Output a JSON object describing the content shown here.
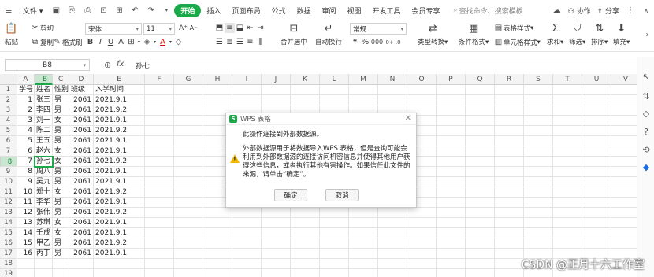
{
  "menubar": {
    "file_label": "文件",
    "tabs": [
      "开始",
      "插入",
      "页面布局",
      "公式",
      "数据",
      "审阅",
      "视图",
      "开发工具",
      "会员专享"
    ],
    "active_tab": "开始",
    "search_placeholder": "查找命令、搜索模板",
    "collab_label": "协作",
    "share_label": "分享"
  },
  "toolbar": {
    "paste_label": "粘贴",
    "cut_label": "剪切",
    "copy_label": "复制",
    "format_painter_label": "格式刷",
    "font_name": "宋体",
    "font_size": "11",
    "merge_center_label": "合并居中",
    "wrap_label": "自动换行",
    "number_format": "常规",
    "type_convert_label": "类型转换",
    "cond_format_label": "条件格式",
    "table_style_label": "表格样式",
    "cell_style_label": "单元格样式",
    "sum_label": "求和",
    "filter_label": "筛选",
    "sort_label": "排序",
    "fill_label": "填充",
    "percent": "%",
    "thousands": "000"
  },
  "formula_bar": {
    "cell_ref": "B8",
    "fx_label": "fx",
    "value": "孙七"
  },
  "sheet": {
    "columns": [
      "A",
      "B",
      "C",
      "D",
      "E",
      "F",
      "G",
      "H",
      "I",
      "J",
      "K",
      "L",
      "M",
      "N",
      "O",
      "P",
      "Q",
      "R",
      "S",
      "T",
      "U",
      "V"
    ],
    "selected_column": "B",
    "selected_row": "8",
    "row_numbers": [
      "1",
      "2",
      "3",
      "4",
      "5",
      "6",
      "7",
      "8",
      "9",
      "10",
      "11",
      "12",
      "13",
      "14",
      "15",
      "16",
      "17",
      "18",
      "19"
    ],
    "rows": [
      [
        "学号",
        "姓名",
        "性别",
        "班级",
        "入学时间"
      ],
      [
        "1",
        "张三",
        "男",
        "2061",
        "2021.9.1"
      ],
      [
        "2",
        "李四",
        "男",
        "2061",
        "2021.9.2"
      ],
      [
        "3",
        "刘一",
        "女",
        "2061",
        "2021.9.1"
      ],
      [
        "4",
        "陈二",
        "男",
        "2061",
        "2021.9.2"
      ],
      [
        "5",
        "王五",
        "男",
        "2061",
        "2021.9.1"
      ],
      [
        "6",
        "赵六",
        "女",
        "2061",
        "2021.9.1"
      ],
      [
        "7",
        "孙七",
        "女",
        "2061",
        "2021.9.2"
      ],
      [
        "8",
        "周八",
        "男",
        "2061",
        "2021.9.1"
      ],
      [
        "9",
        "吴九",
        "男",
        "2061",
        "2021.9.1"
      ],
      [
        "10",
        "郑十",
        "女",
        "2061",
        "2021.9.2"
      ],
      [
        "11",
        "李华",
        "男",
        "2061",
        "2021.9.1"
      ],
      [
        "12",
        "张伟",
        "男",
        "2061",
        "2021.9.2"
      ],
      [
        "13",
        "苏琪",
        "女",
        "2061",
        "2021.9.1"
      ],
      [
        "14",
        "壬戌",
        "女",
        "2061",
        "2021.9.1"
      ],
      [
        "15",
        "甲乙",
        "男",
        "2061",
        "2021.9.2"
      ],
      [
        "16",
        "丙丁",
        "男",
        "2061",
        "2021.9.1"
      ],
      [
        "",
        "",
        "",
        "",
        ""
      ],
      [
        "",
        "",
        "",
        "",
        ""
      ]
    ]
  },
  "dialog": {
    "title": "WPS 表格",
    "message1": "此操作连接到外部数据源。",
    "message2": "外部数据源用于将数据导入WPS 表格，但是查询可能会利用到外部数据源的连接访问机密信息并使得其他用户获得这些信息，或者执行其他有害操作。如果信任此文件的来源，请单击“确定”。",
    "ok_label": "确定",
    "cancel_label": "取消",
    "close_glyph": "✕"
  },
  "watermark": "CSDN @正月十六工作室",
  "colors": {
    "accent": "#1aaa4a",
    "warning": "#f5b800"
  }
}
